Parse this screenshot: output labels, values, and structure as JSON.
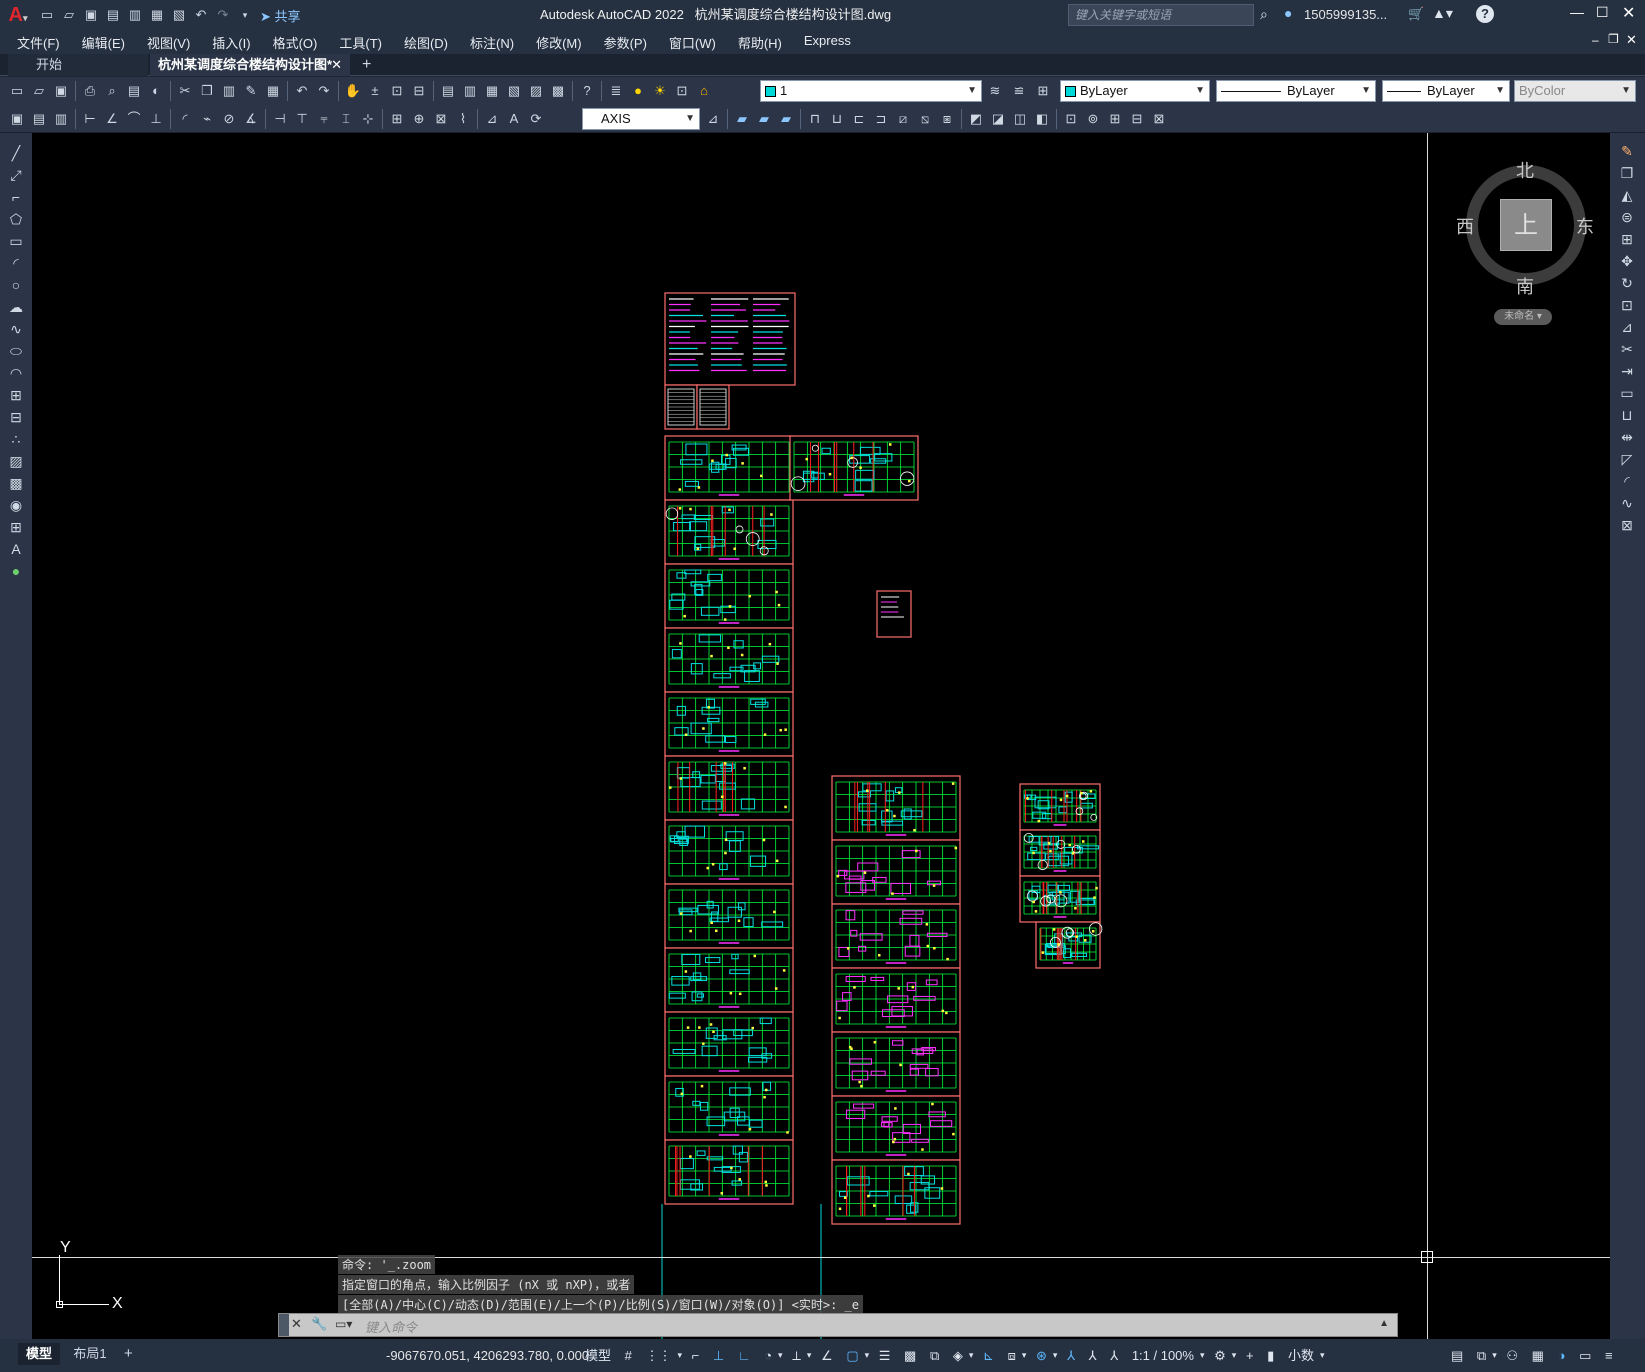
{
  "app": {
    "title": "Autodesk AutoCAD 2022",
    "filename": "杭州某调度综合楼结构设计图.dwg",
    "share_label": "共享",
    "search_placeholder": "键入关键字或短语",
    "user": "1505999135...",
    "help": "?"
  },
  "menu": [
    "文件(F)",
    "编辑(E)",
    "视图(V)",
    "插入(I)",
    "格式(O)",
    "工具(T)",
    "绘图(D)",
    "标注(N)",
    "修改(M)",
    "参数(P)",
    "窗口(W)",
    "帮助(H)",
    "Express"
  ],
  "tabs": {
    "start": "开始",
    "active": "杭州某调度综合楼结构设计图*",
    "close": "✕",
    "add": "+"
  },
  "properties": {
    "layer": "1",
    "color": "ByLayer",
    "linetype": "ByLayer",
    "lineweight": "ByLayer",
    "plotstyle": "ByColor",
    "dimstyle": "AXIS",
    "layer_color": "#00d8d8"
  },
  "viewcube": {
    "north": "北",
    "south": "南",
    "east": "东",
    "west": "西",
    "face": "上",
    "wcs": "未命名"
  },
  "ucs": {
    "x": "X",
    "y": "Y"
  },
  "command": {
    "history": [
      "命令: '_.zoom",
      "指定窗口的角点，输入比例因子 (nX 或 nXP)，或者",
      "[全部(A)/中心(C)/动态(D)/范围(E)/上一个(P)/比例(S)/窗口(W)/对象(O)] <实时>: _e"
    ],
    "placeholder": "键入命令"
  },
  "status": {
    "model_tab": "模型",
    "layout_tab": "布局1",
    "add_tab": "+",
    "coords": "-9067670.051, 4206293.780, 0.000",
    "model_button": "模型",
    "scale": "1:1 / 100%",
    "units": "小数"
  }
}
